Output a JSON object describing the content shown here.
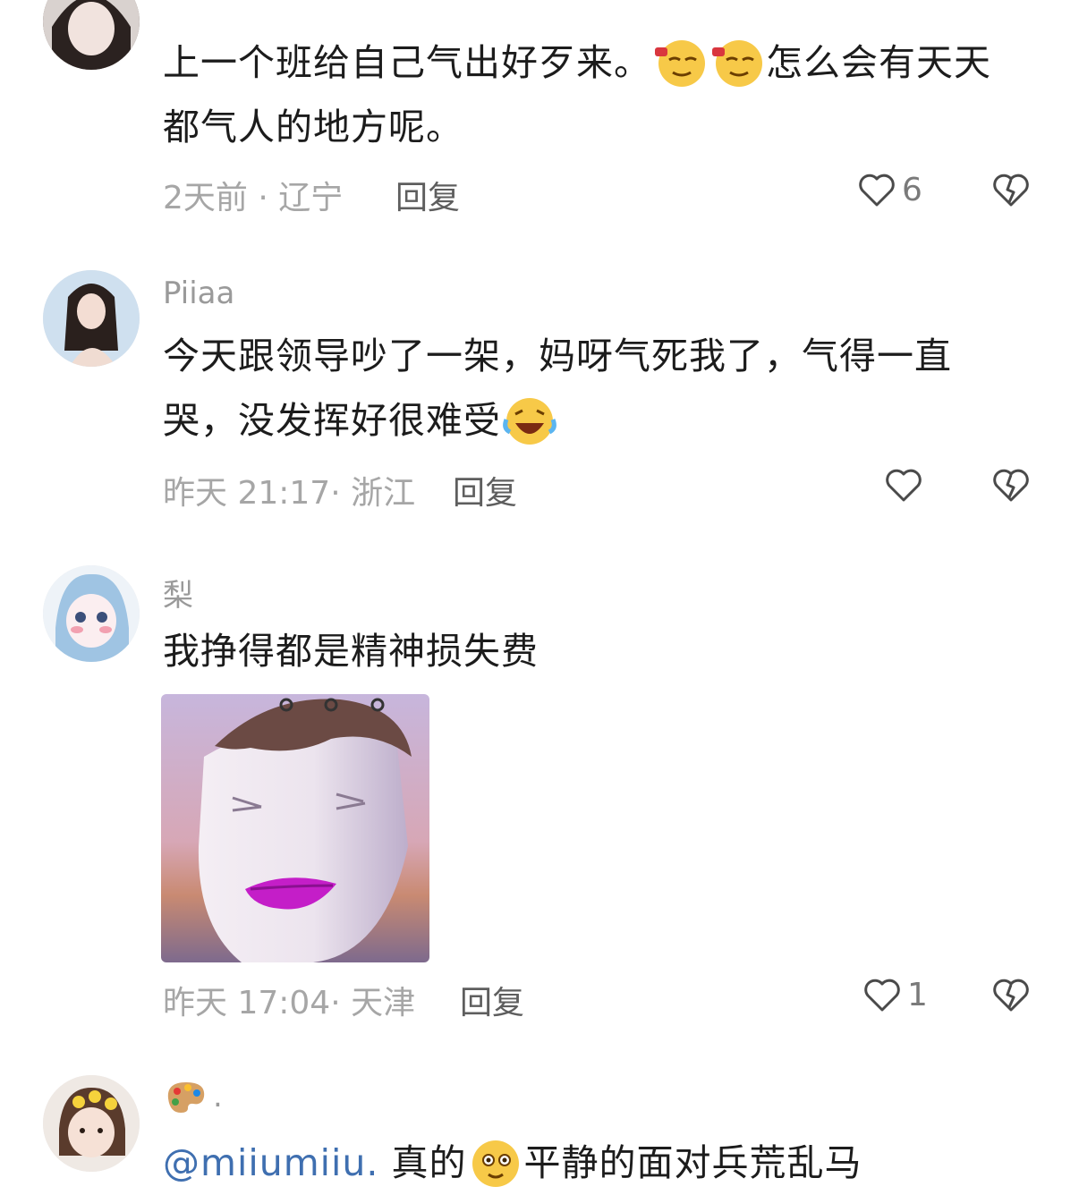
{
  "comments": [
    {
      "username": "",
      "text_a": "上一个班给自己气出好歹来。",
      "emoji_a": "wine-smirk-emoji",
      "emoji_b": "wine-smirk-emoji",
      "text_b": "怎么会有天天",
      "text_c": "都气人的地方呢。",
      "time": "2天前",
      "location": "辽宁",
      "reply_label": "回复",
      "like_count": "6"
    },
    {
      "username": "Piiaa",
      "text_a": "今天跟领导吵了一架，妈呀气死我了，气得一直",
      "text_b": "哭，没发挥好很难受",
      "emoji_a": "crying-laughing-emoji",
      "time": "昨天 21:17",
      "location": "浙江",
      "reply_label": "回复",
      "like_count": ""
    },
    {
      "username": "梨",
      "text_a": "我挣得都是精神损失费",
      "sticker": "meme-face-sticker",
      "time": "昨天 17:04",
      "location": "天津",
      "reply_label": "回复",
      "like_count": "1"
    },
    {
      "username_emoji": "palette-emoji",
      "username": ".",
      "mention": "@miiumiiu.",
      "text_a": "真的",
      "emoji_a": "calm-smile-emoji",
      "text_b": "平静的面对兵荒乱马"
    }
  ],
  "colors": {
    "meta": "#a6a6a6",
    "mention": "#3f6fb0",
    "text": "#1c1c1c"
  }
}
